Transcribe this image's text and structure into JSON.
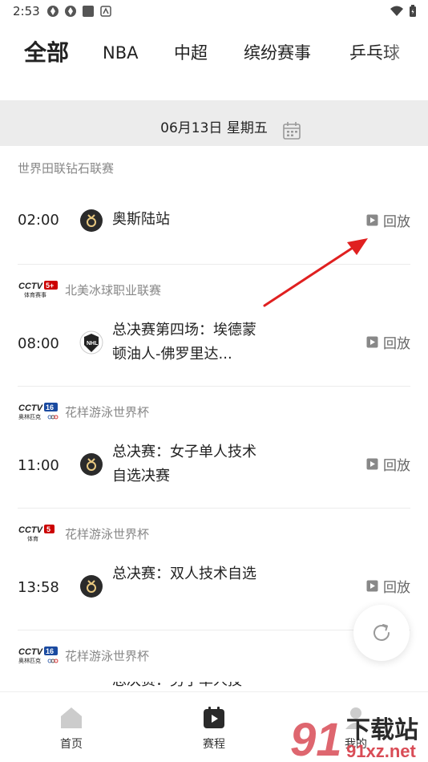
{
  "status_bar": {
    "time": "2:53"
  },
  "tabs": [
    {
      "label": "全部",
      "active": true
    },
    {
      "label": "NBA",
      "active": false
    },
    {
      "label": "中超",
      "active": false
    },
    {
      "label": "缤纷赛事",
      "active": false
    },
    {
      "label": "乒乓球",
      "active": false
    }
  ],
  "date_bar": {
    "date": "06月13日  星期五"
  },
  "sections": [
    {
      "channel_logo": "",
      "title": "世界田联钻石联赛",
      "match": {
        "time": "02:00",
        "title": "奥斯陆站",
        "action": "回放",
        "icon": "medal-icon"
      }
    },
    {
      "channel_logo": "CCTV5+",
      "title": "北美冰球职业联赛",
      "match": {
        "time": "08:00",
        "title": "总决赛第四场：埃德蒙顿油人-佛罗里达...",
        "action": "回放",
        "icon": "nhl-icon"
      }
    },
    {
      "channel_logo": "CCTV16",
      "title": "花样游泳世界杯",
      "match": {
        "time": "11:00",
        "title": "总决赛：女子单人技术自选决赛",
        "action": "回放",
        "icon": "medal-icon"
      }
    },
    {
      "channel_logo": "CCTV5",
      "title": "花样游泳世界杯",
      "match": {
        "time": "13:58",
        "title": "总决赛：双人技术自选",
        "action": "回放",
        "icon": "medal-icon"
      }
    },
    {
      "channel_logo": "CCTV16",
      "title": "花样游泳世界杯",
      "match": {
        "time": "",
        "title": "总决赛：男子单人技",
        "action": "",
        "icon": ""
      }
    }
  ],
  "bottom_nav": [
    {
      "label": "首页",
      "icon": "home-icon"
    },
    {
      "label": "赛程",
      "icon": "schedule-icon"
    },
    {
      "label": "我的",
      "icon": "profile-icon"
    }
  ],
  "watermark": {
    "text": "下载站",
    "url_text": "91xz.net"
  },
  "colors": {
    "annotation_arrow": "#e02020",
    "date_bar_bg": "#ececec"
  }
}
